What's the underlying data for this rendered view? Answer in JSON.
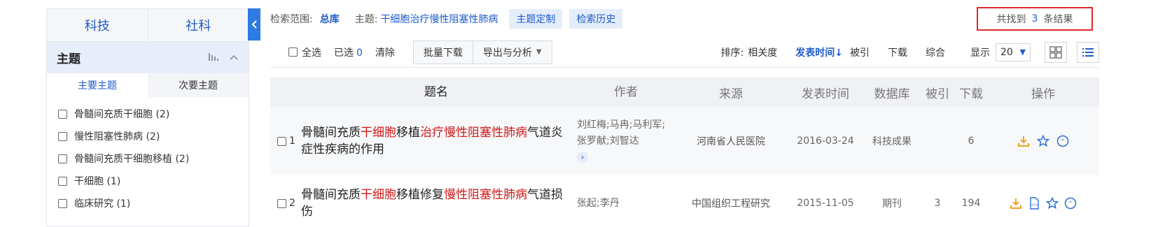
{
  "sidebar": {
    "categories": [
      "科技",
      "社科"
    ],
    "topic_title": "主题",
    "sub_tabs": [
      "主要主题",
      "次要主题"
    ],
    "topics": [
      "骨髓间充质干细胞 (2)",
      "慢性阻塞性肺病 (2)",
      "骨髓间充质干细胞移植 (2)",
      "干细胞 (1)",
      "临床研究 (1)"
    ]
  },
  "info_bar": {
    "scope_label": "检索范围:",
    "scope_value": "总库",
    "topic_label": "主题:",
    "topic_value": "干细胞治疗慢性阻塞性肺病",
    "customize_label": "主题定制",
    "history_label": "检索历史"
  },
  "results": {
    "prefix": "共找到",
    "count": "3",
    "suffix": "条结果"
  },
  "toolbar": {
    "select_all": "全选",
    "selected_label": "已选",
    "selected_count": "0",
    "clear": "清除",
    "batch_download": "批量下载",
    "export_analyze": "导出与分析",
    "sort_label": "排序:",
    "sort_relevance": "相关度",
    "sort_date": "发表时间",
    "sort_cited": "被引",
    "sort_download": "下载",
    "sort_overall": "综合",
    "display_label": "显示",
    "page_size": "20"
  },
  "table": {
    "headers": [
      "题名",
      "作者",
      "来源",
      "发表时间",
      "数据库",
      "被引",
      "下载",
      "操作"
    ],
    "rows": [
      {
        "no": "1",
        "title_parts": [
          "骨髓间充质",
          "干细胞",
          "移植",
          "治疗慢性阻塞性肺病",
          "气道炎症性疾病的作用"
        ],
        "authors": "刘红梅;马冉;马利军;张罗献;刘智达",
        "source": "河南省人民医院",
        "date": "2016-03-24",
        "database": "科技成果",
        "cited": "",
        "downloads": "6"
      },
      {
        "no": "2",
        "title_parts": [
          "骨髓间充质",
          "干细胞",
          "移植修复",
          "慢性阻塞性肺病",
          "气道损伤"
        ],
        "authors": "张起;李丹",
        "source": "中国组织工程研究",
        "date": "2015-11-05",
        "database": "期刊",
        "cited": "3",
        "downloads": "194"
      }
    ]
  },
  "colors": {
    "accent": "#1f5cc7",
    "highlight": "#d11a1a",
    "result_border": "#e0282e",
    "op_orange": "#f0a020"
  }
}
